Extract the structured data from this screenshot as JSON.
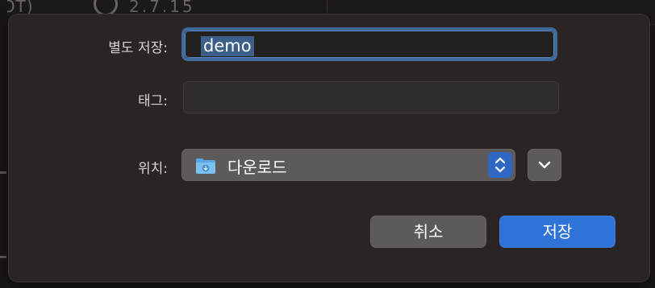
{
  "background": {
    "left_text": "JOT)",
    "right_text": "2.7.15"
  },
  "dialog": {
    "save_as_label": "별도 저장:",
    "save_as_value": "demo",
    "tags_label": "태그:",
    "tags_value": "",
    "location_label": "위치:",
    "location_value": "다운로드",
    "cancel_label": "취소",
    "save_label": "저장"
  },
  "icons": {
    "location_folder": "downloads-folder-icon",
    "location_stepper": "up-down-chevron-icon",
    "expand": "chevron-down-icon",
    "background_search": "search-icon"
  },
  "colors": {
    "accent": "#2f72d8",
    "focus_ring": "#3f6a9b",
    "selection": "#3c5f8a",
    "folder": "#5aa7e6"
  }
}
